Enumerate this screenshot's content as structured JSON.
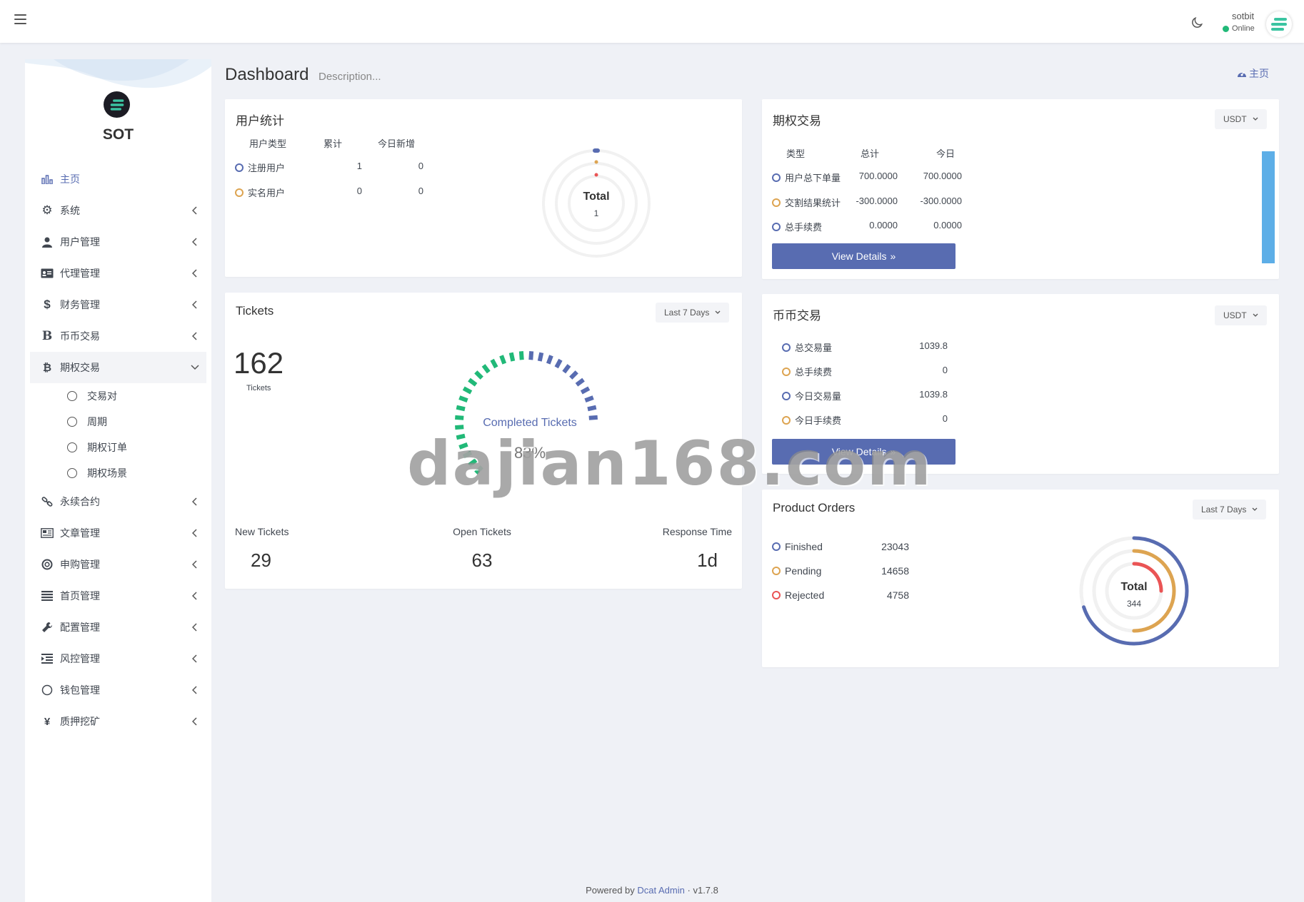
{
  "colors": {
    "primary": "#586cb1",
    "orange": "#dda451",
    "red": "#ea5455",
    "green": "#21b978",
    "teal": "#3bc4a1"
  },
  "navbar": {
    "user_name": "sotbit",
    "user_status": "Online"
  },
  "sidebar": {
    "brand": "SOT",
    "items": [
      {
        "label": "主页",
        "icon": "bar-chart-icon"
      },
      {
        "label": "系统",
        "icon": "gear-icon"
      },
      {
        "label": "用户管理",
        "icon": "users-icon"
      },
      {
        "label": "代理管理",
        "icon": "id-card-icon"
      },
      {
        "label": "财务管理",
        "icon": "dollar-icon"
      },
      {
        "label": "币币交易",
        "icon": "bitcoin-b-icon"
      },
      {
        "label": "期权交易",
        "icon": "bitcoin-icon"
      },
      {
        "label": "永续合约",
        "icon": "link-icon"
      },
      {
        "label": "文章管理",
        "icon": "newspaper-icon"
      },
      {
        "label": "申购管理",
        "icon": "lifebuoy-icon"
      },
      {
        "label": "首页管理",
        "icon": "bars-icon"
      },
      {
        "label": "配置管理",
        "icon": "wrench-icon"
      },
      {
        "label": "风控管理",
        "icon": "indent-icon"
      },
      {
        "label": "钱包管理",
        "icon": "circle-icon"
      },
      {
        "label": "质押挖矿",
        "icon": "yen-icon"
      }
    ],
    "submenu": [
      "交易对",
      "周期",
      "期权订单",
      "期权场景"
    ]
  },
  "header": {
    "title": "Dashboard",
    "description": "Description...",
    "breadcrumb": "主页"
  },
  "user_stats": {
    "title": "用户统计",
    "columns": [
      "用户类型",
      "累计",
      "今日新增"
    ],
    "rows": [
      {
        "type": "注册用户",
        "total": "1",
        "today": "0"
      },
      {
        "type": "实名用户",
        "total": "0",
        "today": "0"
      }
    ],
    "chart_label": "Total",
    "chart_value": "1"
  },
  "options_trading": {
    "title": "期权交易",
    "currency": "USDT",
    "columns": [
      "类型",
      "总计",
      "今日"
    ],
    "rows": [
      {
        "type": "用户总下单量",
        "total": "700.0000",
        "today": "700.0000"
      },
      {
        "type": "交割结果统计",
        "total": "-300.0000",
        "today": "-300.0000"
      },
      {
        "type": "总手续费",
        "total": "0.0000",
        "today": "0.0000"
      }
    ],
    "button": "View Details"
  },
  "tickets": {
    "title": "Tickets",
    "period": "Last 7 Days",
    "count": "162",
    "count_label": "Tickets",
    "chart_label": "Completed Tickets",
    "chart_value": "83%",
    "completed_fraction": 0.83,
    "stats": [
      {
        "label": "New Tickets",
        "value": "29"
      },
      {
        "label": "Open Tickets",
        "value": "63"
      },
      {
        "label": "Response Time",
        "value": "1d"
      }
    ]
  },
  "coin_trading": {
    "title": "币币交易",
    "currency": "USDT",
    "rows": [
      {
        "label": "总交易量",
        "value": "1039.8"
      },
      {
        "label": "总手续费",
        "value": "0"
      },
      {
        "label": "今日交易量",
        "value": "1039.8"
      },
      {
        "label": "今日手续费",
        "value": "0"
      }
    ],
    "button": "View Details"
  },
  "product_orders": {
    "title": "Product Orders",
    "period": "Last 7 Days",
    "rows": [
      {
        "label": "Finished",
        "value": "23043"
      },
      {
        "label": "Pending",
        "value": "14658"
      },
      {
        "label": "Rejected",
        "value": "4758"
      }
    ],
    "chart_label": "Total",
    "chart_value": "344",
    "fractions": [
      0.7,
      0.5,
      0.25
    ]
  },
  "footer": {
    "powered_by": "Powered by",
    "link": "Dcat Admin",
    "sep": "·",
    "version": "v1.7.8"
  },
  "watermark": "dajian168.com"
}
